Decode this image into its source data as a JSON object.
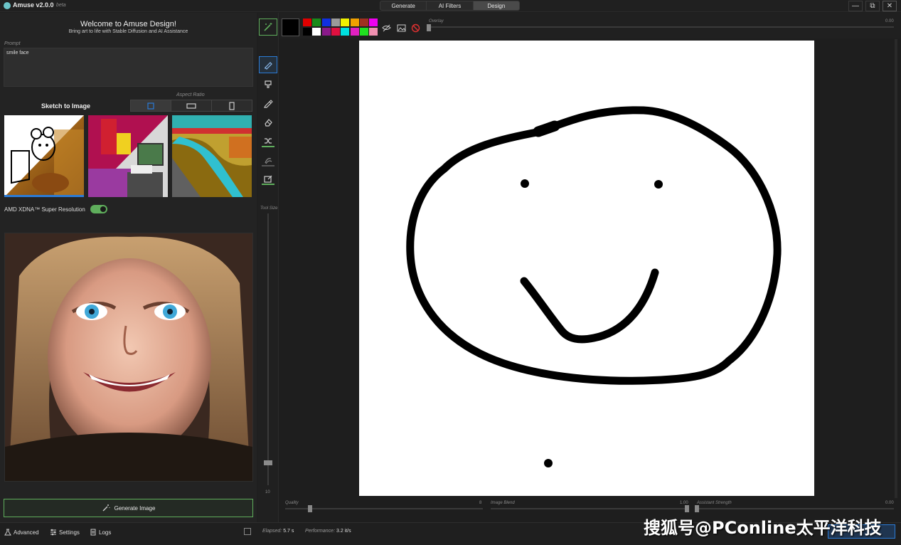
{
  "window": {
    "title": "Amuse v2.0.0",
    "beta": "beta",
    "tabs": [
      {
        "label": "Generate",
        "active": false
      },
      {
        "label": "AI Filters",
        "active": false
      },
      {
        "label": "Design",
        "active": true
      }
    ],
    "controls": {
      "minimize": "—",
      "restore": "⧉",
      "close": "✕"
    }
  },
  "left": {
    "welcome_title": "Welcome to Amuse Design!",
    "welcome_subtitle": "Bring art to life with Stable Diffusion and AI Assistance",
    "prompt_label": "Prompt",
    "prompt_value": "smile face",
    "mode_label": "Sketch to Image",
    "aspect_label": "Aspect Ratio",
    "aspect_options": [
      "square",
      "landscape",
      "portrait"
    ],
    "aspect_selected": "square",
    "super_res_label": "AMD XDNA™ Super Resolution",
    "super_res_on": true,
    "generate_label": "Generate Image"
  },
  "footer": {
    "advanced": "Advanced",
    "settings": "Settings",
    "logs": "Logs",
    "elapsed_label": "Elapsed:",
    "elapsed_value": "5.7 s",
    "performance_label": "Performance:",
    "performance_value": "3.2 it/s"
  },
  "tools": {
    "size_label": "Tool Size",
    "size_value": "10"
  },
  "palette": {
    "current": "#000000",
    "row1": [
      "#e00000",
      "#1a8a1a",
      "#1030e0",
      "#9a9a9a",
      "#f0f000",
      "#f0a000",
      "#a03020",
      "#f000f0"
    ],
    "row2": [
      "#000000",
      "#ffffff",
      "#8a1a8a",
      "#e01040",
      "#00e0e0",
      "#e020c0",
      "#20e020",
      "#f090b0"
    ],
    "overlay_label": "Overlay",
    "overlay_value": "0.00"
  },
  "sliders": {
    "quality_label": "Quality",
    "quality_value": "8",
    "blend_label": "Image Blend",
    "blend_value": "1.00",
    "assistant_label": "Assistant Strength",
    "assistant_value": "0.00"
  },
  "watermark": "搜狐号@PConline太平洋科技",
  "colors": {
    "accent_green": "#5fae5c",
    "accent_blue": "#2b7bd6"
  }
}
